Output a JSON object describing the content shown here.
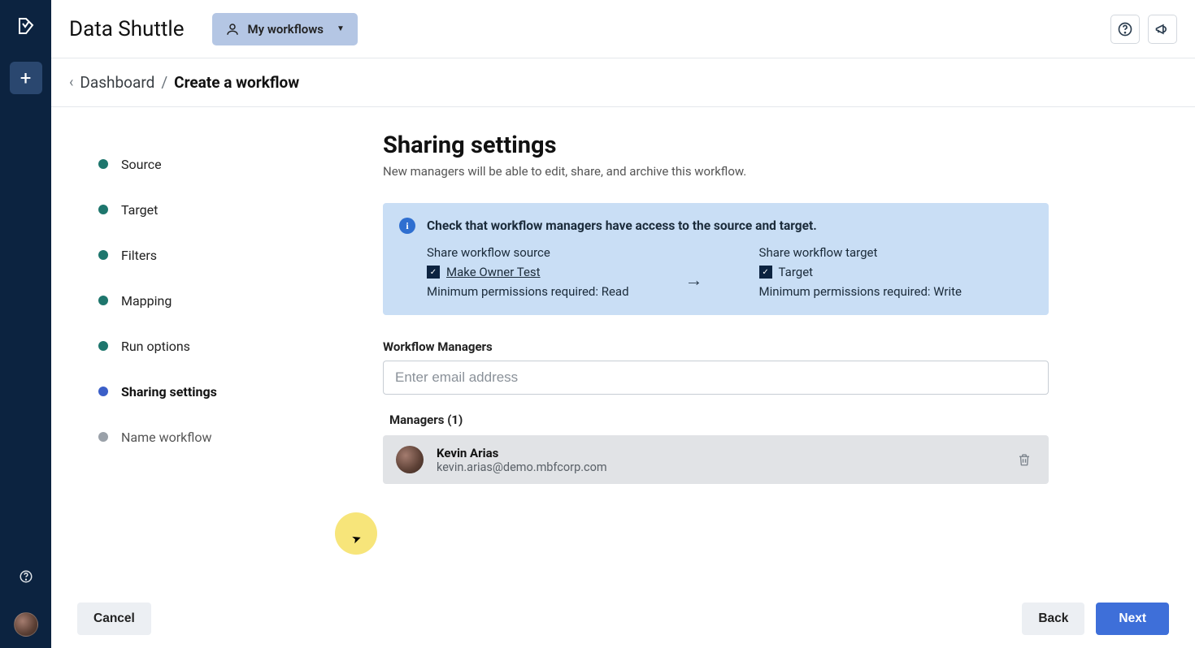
{
  "appTitle": "Data Shuttle",
  "dropdown": {
    "label": "My workflows"
  },
  "breadcrumb": {
    "back": "Dashboard",
    "current": "Create a workflow"
  },
  "steps": [
    {
      "label": "Source",
      "state": "done"
    },
    {
      "label": "Target",
      "state": "done"
    },
    {
      "label": "Filters",
      "state": "done"
    },
    {
      "label": "Mapping",
      "state": "done"
    },
    {
      "label": "Run options",
      "state": "done"
    },
    {
      "label": "Sharing settings",
      "state": "active"
    },
    {
      "label": "Name workflow",
      "state": "pending"
    }
  ],
  "page": {
    "title": "Sharing settings",
    "subtitle": "New managers will be able to edit, share, and archive this workflow."
  },
  "info": {
    "heading": "Check that workflow managers have access to the source and target.",
    "source": {
      "label": "Share workflow source",
      "linkText": "Make Owner Test",
      "perm": "Minimum permissions required: Read"
    },
    "target": {
      "label": "Share workflow target",
      "linkText": "Target",
      "perm": "Minimum permissions required: Write"
    }
  },
  "managers": {
    "fieldLabel": "Workflow Managers",
    "placeholder": "Enter email address",
    "listHeading": "Managers (1)",
    "list": [
      {
        "name": "Kevin Arias",
        "email": "kevin.arias@demo.mbfcorp.com"
      }
    ]
  },
  "footer": {
    "cancel": "Cancel",
    "back": "Back",
    "next": "Next"
  }
}
